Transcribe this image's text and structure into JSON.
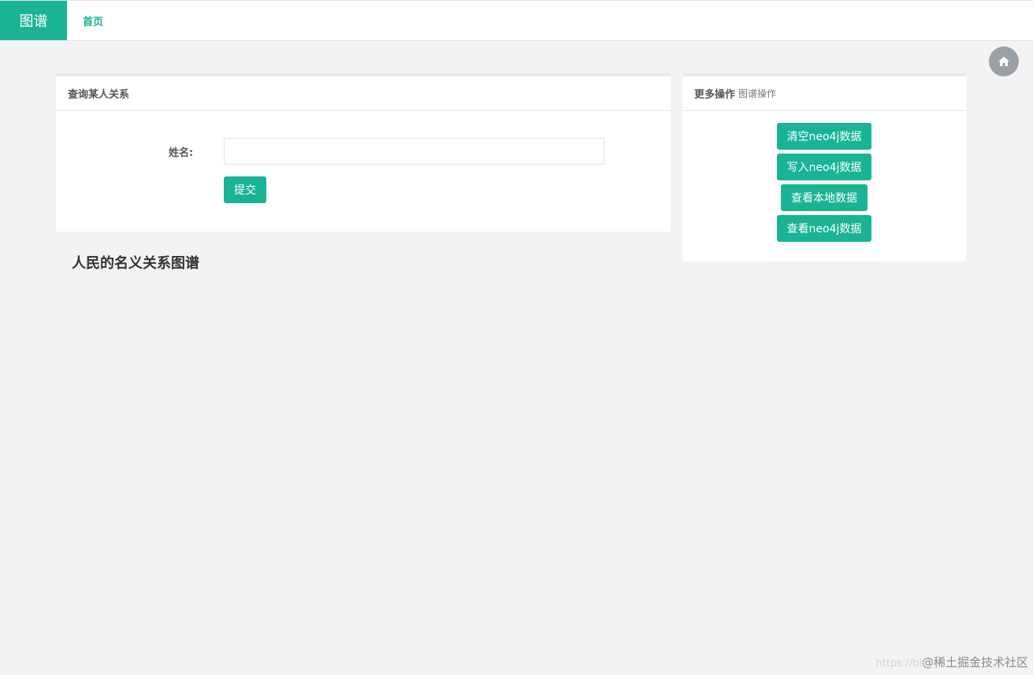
{
  "header": {
    "brand": "图谱",
    "nav_home": "首页"
  },
  "icons": {
    "home": "home-icon"
  },
  "query_panel": {
    "title": "查询某人关系",
    "name_label": "姓名:",
    "name_value": "",
    "submit_label": "提交"
  },
  "ops_panel": {
    "title": "更多操作",
    "subtitle": "图谱操作",
    "buttons": [
      "清空neo4j数据",
      "写入neo4j数据",
      "查看本地数据",
      "查看neo4j数据"
    ]
  },
  "graph": {
    "title": "人民的名义关系图谱"
  },
  "watermark": {
    "url_prefix": "https://bl",
    "text": "@稀土掘金技术社区"
  },
  "colors": {
    "accent": "#1ab394",
    "background": "#f3f3f3",
    "home_circle": "#9aa0a6"
  }
}
